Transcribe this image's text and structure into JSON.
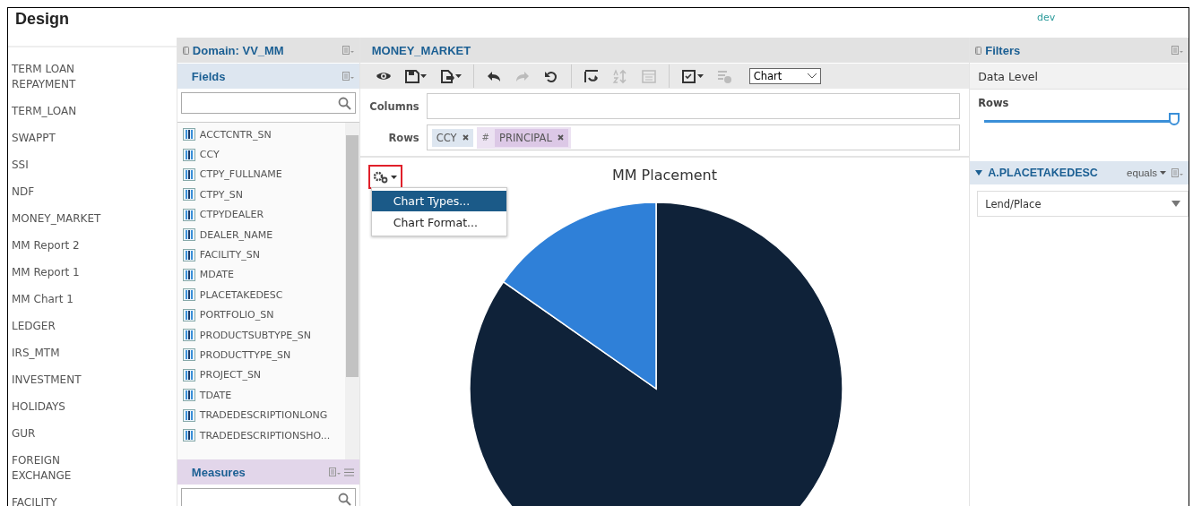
{
  "header": {
    "title": "Design",
    "environment": "dev"
  },
  "sidebar": {
    "items": [
      {
        "label": "TERM LOAN REPAYMENT"
      },
      {
        "label": "TERM_LOAN"
      },
      {
        "label": "SWAPPT"
      },
      {
        "label": "SSI"
      },
      {
        "label": "NDF"
      },
      {
        "label": "MONEY_MARKET"
      },
      {
        "label": "MM Report 2"
      },
      {
        "label": "MM Report 1"
      },
      {
        "label": "MM Chart 1"
      },
      {
        "label": "LEDGER"
      },
      {
        "label": "IRS_MTM"
      },
      {
        "label": "INVESTMENT"
      },
      {
        "label": "HOLIDAYS"
      },
      {
        "label": "GUR"
      },
      {
        "label": "FOREIGN EXCHANGE"
      },
      {
        "label": "FACILITY"
      }
    ]
  },
  "domain_panel": {
    "title": "Domain: VV_MM",
    "fields_title": "Fields",
    "fields": [
      "ACCTCNTR_SN",
      "CCY",
      "CTPY_FULLNAME",
      "CTPY_SN",
      "CTPYDEALER",
      "DEALER_NAME",
      "FACILITY_SN",
      "MDATE",
      "PLACETAKEDESC",
      "PORTFOLIO_SN",
      "PRODUCTSUBTYPE_SN",
      "PRODUCTTYPE_SN",
      "PROJECT_SN",
      "TDATE",
      "TRADEDESCRIPTIONLONG",
      "TRADEDESCRIPTIONSHO..."
    ],
    "measures_title": "Measures"
  },
  "report": {
    "title": "MONEY_MARKET",
    "toolbar": [
      {
        "disabled": false
      },
      {
        "disabled": false
      },
      {
        "disabled": false
      },
      {
        "disabled": false
      },
      {
        "disabled": true
      },
      {
        "disabled": false
      },
      {
        "disabled": false
      },
      {
        "disabled": true
      },
      {
        "disabled": true
      },
      {
        "disabled": false
      },
      {
        "disabled": true
      }
    ],
    "view_select": "Chart",
    "columns_label": "Columns",
    "rows_label": "Rows",
    "row_chips": [
      {
        "label": "CCY",
        "kind": "dimension"
      },
      {
        "label": "PRINCIPAL",
        "kind": "measure",
        "prefix": "#"
      }
    ],
    "chart_title": "MM Placement",
    "menu": [
      {
        "label": "Chart Types...",
        "selected": true
      },
      {
        "label": "Chart Format...",
        "selected": false
      }
    ]
  },
  "filters": {
    "title": "Filters",
    "data_level": "Data Level",
    "rows_label": "Rows",
    "level": 1,
    "filter": {
      "field": "A.PLACETAKEDESC",
      "operator": "equals",
      "value": "Lend/Place",
      "expanded": true
    }
  }
}
